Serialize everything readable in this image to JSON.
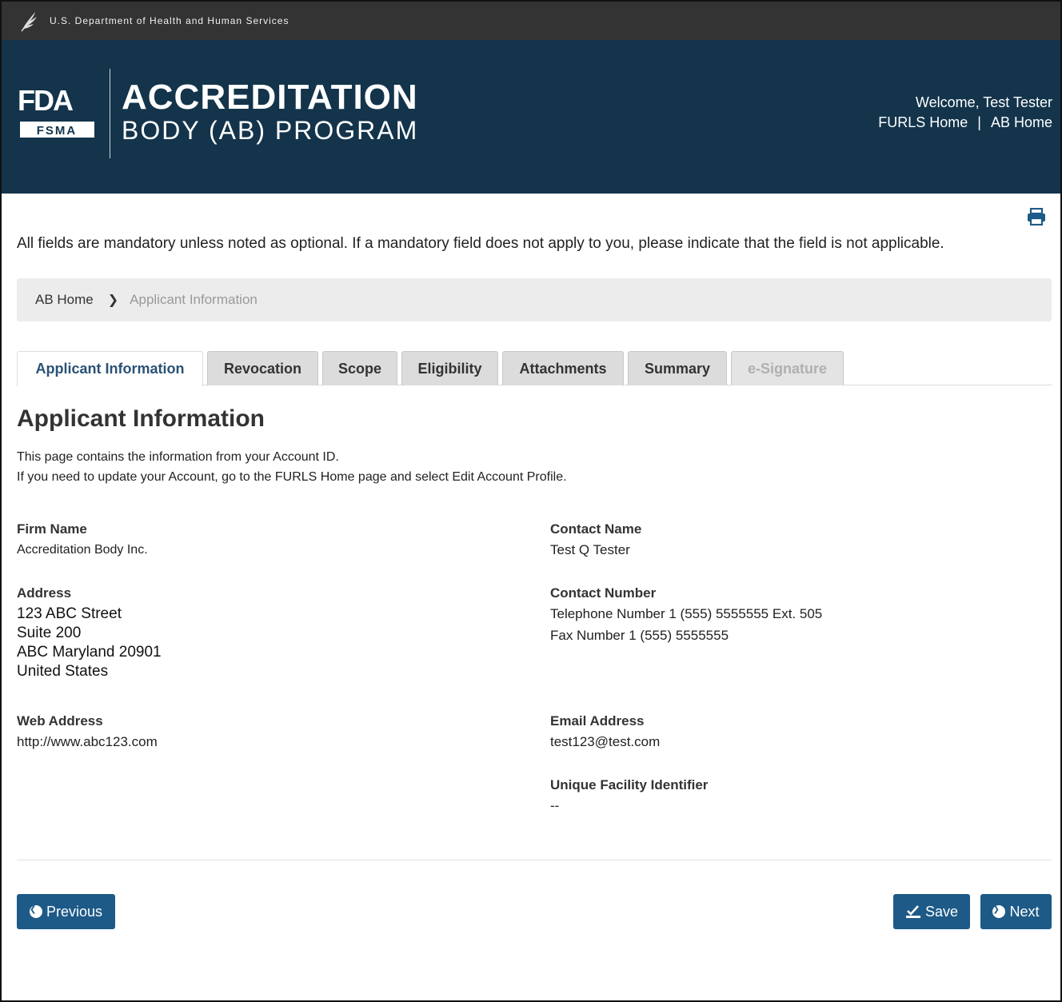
{
  "header": {
    "department": "U.S. Department of Health and Human Services",
    "logo_top": "FDA",
    "logo_badge": "FSMA",
    "title_line1": "ACCREDITATION",
    "title_line2": "BODY (AB) PROGRAM",
    "welcome": "Welcome, Test Tester",
    "link_furls": "FURLS Home",
    "link_separator": "|",
    "link_ab": "AB Home"
  },
  "intro_text": "All fields are mandatory unless noted as optional. If a mandatory field does not apply to you, please indicate that the field is not applicable.",
  "breadcrumb": {
    "home": "AB Home",
    "current": "Applicant Information"
  },
  "tabs": [
    {
      "label": "Applicant Information",
      "state": "active"
    },
    {
      "label": "Revocation",
      "state": "normal"
    },
    {
      "label": "Scope",
      "state": "normal"
    },
    {
      "label": "Eligibility",
      "state": "normal"
    },
    {
      "label": "Attachments",
      "state": "normal"
    },
    {
      "label": "Summary",
      "state": "normal"
    },
    {
      "label": "e-Signature",
      "state": "disabled"
    }
  ],
  "page": {
    "heading": "Applicant Information",
    "desc_line1": "This page contains the information from your Account ID.",
    "desc_line2": "If you need to update your Account, go to the FURLS Home page and select Edit Account Profile."
  },
  "fields": {
    "firm_name_label": "Firm Name",
    "firm_name": "Accreditation Body Inc.",
    "address_label": "Address",
    "address_lines": [
      "123 ABC Street",
      "Suite 200",
      "ABC Maryland 20901",
      "United States"
    ],
    "web_label": "Web Address",
    "web": "http://www.abc123.com",
    "contact_name_label": "Contact Name",
    "contact_name": "Test Q Tester",
    "contact_number_label": "Contact Number",
    "telephone": "Telephone Number 1 (555) 5555555 Ext. 505",
    "fax": "Fax Number 1 (555) 5555555",
    "email_label": "Email Address",
    "email": "test123@test.com",
    "ufi_label": "Unique Facility Identifier",
    "ufi": "--"
  },
  "buttons": {
    "previous": "Previous",
    "save": "Save",
    "next": "Next"
  },
  "colors": {
    "banner": "#13344b",
    "topbar": "#333333",
    "button": "#1d5a87",
    "active_tab_text": "#2a5275"
  }
}
